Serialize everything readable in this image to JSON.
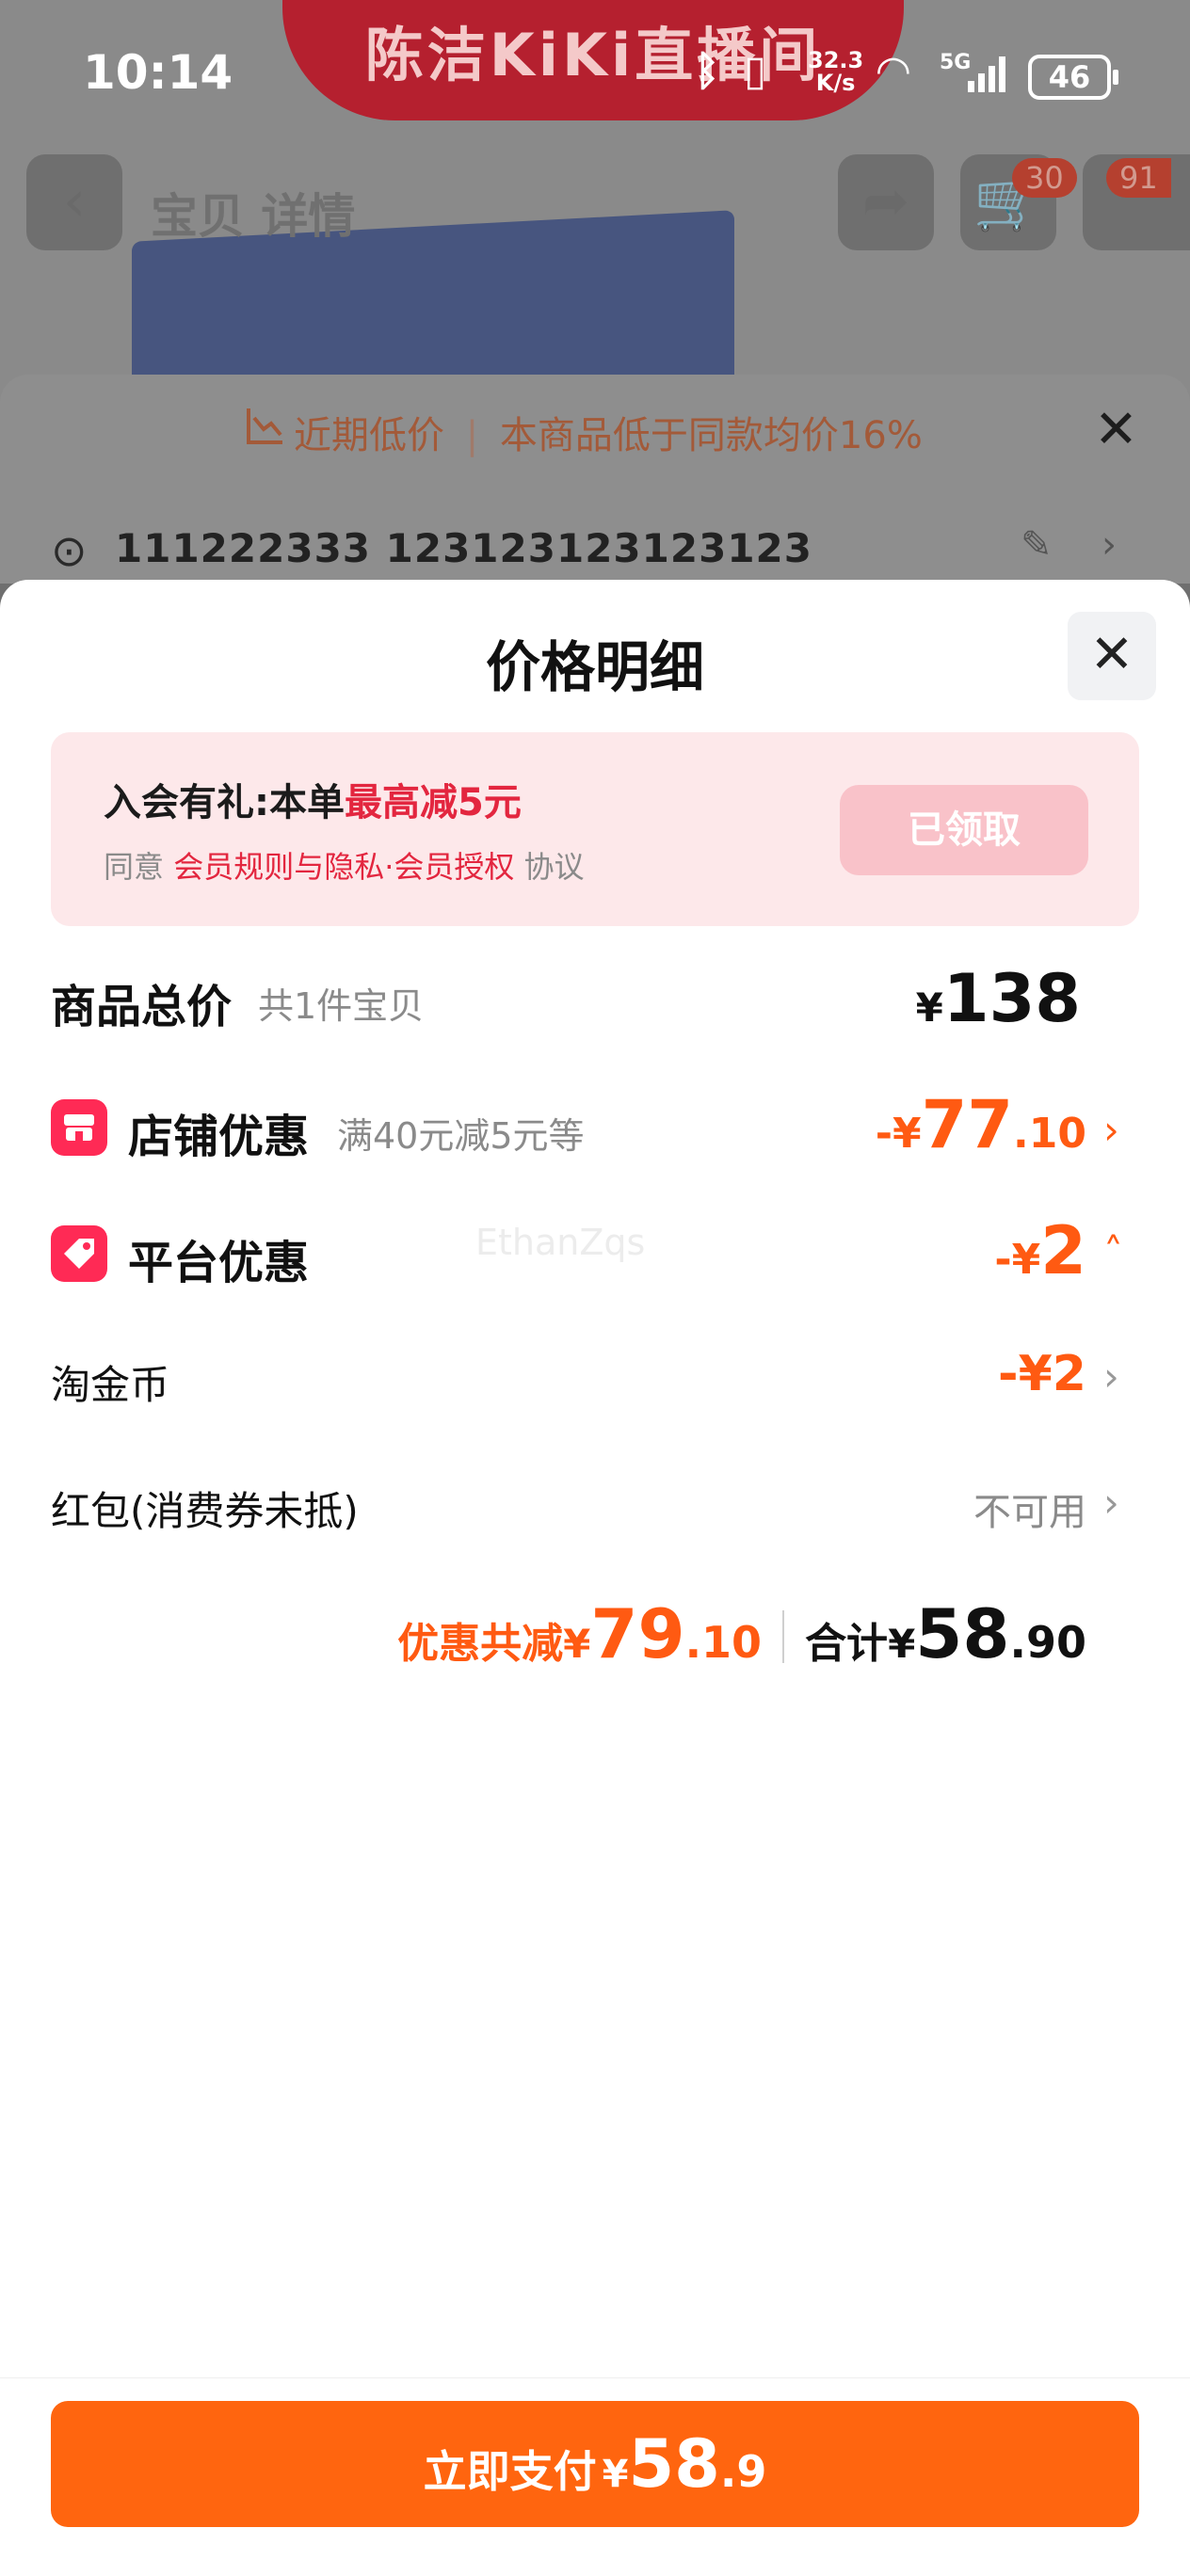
{
  "status_bar": {
    "time": "10:14",
    "net_speed_value": "32.3",
    "net_speed_unit": "K/s",
    "network": "5G",
    "battery": "46"
  },
  "background": {
    "live_banner": "陈洁KiKi直播间",
    "nav_title": "宝贝 详情",
    "cart_badge": "30",
    "message_badge": "91",
    "low_price_tag": "近期低价",
    "low_price_desc": "本商品低于同款均价16%",
    "address": "111222333 123123123123123"
  },
  "sheet": {
    "title": "价格明细",
    "member": {
      "prefix": "入会有礼:本单",
      "highlight": "最高减5元",
      "agree": "同意",
      "rules_link": "会员规则与隐私·会员授权",
      "agreement": "协议",
      "button": "已领取"
    },
    "goods_total": {
      "label": "商品总价",
      "sub": "共1件宝贝",
      "yen": "¥",
      "amount": "138"
    },
    "store_discount": {
      "label": "店铺优惠",
      "sub": "满40元减5元等",
      "prefix": "-¥",
      "int": "77",
      "dec": ".10"
    },
    "platform_discount": {
      "label": "平台优惠",
      "prefix": "-¥",
      "int": "2"
    },
    "coins": {
      "label": "淘金币",
      "value": "-¥2"
    },
    "red_packet": {
      "label": "红包(消费券未抵)",
      "value": "不可用"
    },
    "watermark": "EthanZqs",
    "summary": {
      "saved_label": "优惠共减",
      "saved_yen": "¥",
      "saved_int": "79",
      "saved_dec": ".10",
      "total_label": "合计",
      "total_yen": "¥",
      "total_int": "58",
      "total_dec": ".90"
    }
  },
  "pay_button": {
    "label": "立即支付",
    "yen": "¥",
    "int": "58",
    "dec": ".9"
  },
  "colors": {
    "accent": "#ff650f",
    "discount": "#ff5a12",
    "member_red": "#e3263f"
  }
}
